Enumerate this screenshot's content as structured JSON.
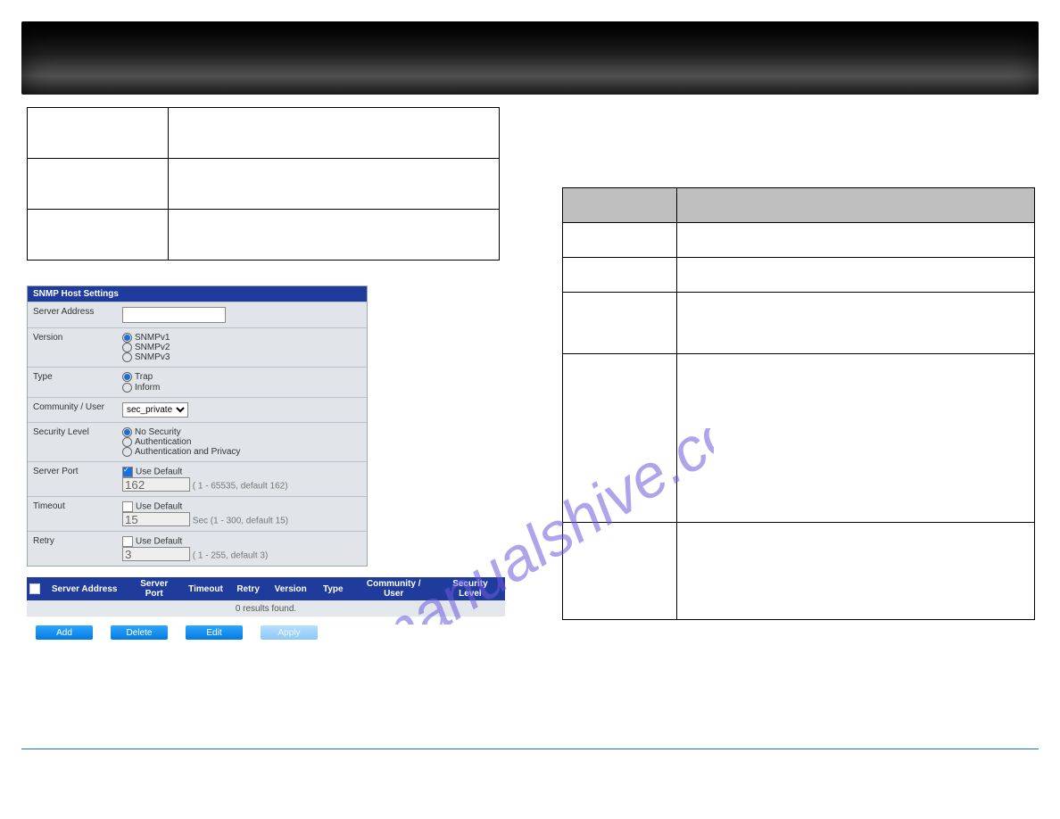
{
  "watermark": "manualshive.com",
  "panel_title": "SNMP Host Settings",
  "form": {
    "server_address": {
      "label": "Server Address",
      "value": ""
    },
    "version": {
      "label": "Version",
      "opts": [
        "SNMPv1",
        "SNMPv2",
        "SNMPv3"
      ],
      "selected": 0
    },
    "type": {
      "label": "Type",
      "opts": [
        "Trap",
        "Inform"
      ],
      "selected": 0
    },
    "community": {
      "label": "Community / User",
      "value": "sec_private"
    },
    "sec_level": {
      "label": "Security Level",
      "opts": [
        "No Security",
        "Authentication",
        "Authentication and Privacy"
      ],
      "selected": 0
    },
    "server_port": {
      "label": "Server Port",
      "use_default": true,
      "use_default_label": "Use Default",
      "value": "162",
      "hint": "( 1 - 65535, default 162)"
    },
    "timeout": {
      "label": "Timeout",
      "use_default": true,
      "use_default_label": "Use Default",
      "value": "15",
      "hint": "Sec (1 - 300, default 15)"
    },
    "retry": {
      "label": "Retry",
      "use_default": true,
      "use_default_label": "Use Default",
      "value": "3",
      "hint": "( 1 - 255, default 3)"
    }
  },
  "grid_headers": [
    "Server Address",
    "Server Port",
    "Timeout",
    "Retry",
    "Version",
    "Type",
    "Community / User",
    "Security Level"
  ],
  "grid_empty": "0 results found.",
  "buttons": {
    "add": "Add",
    "delete": "Delete",
    "edit": "Edit",
    "apply": "Apply"
  }
}
